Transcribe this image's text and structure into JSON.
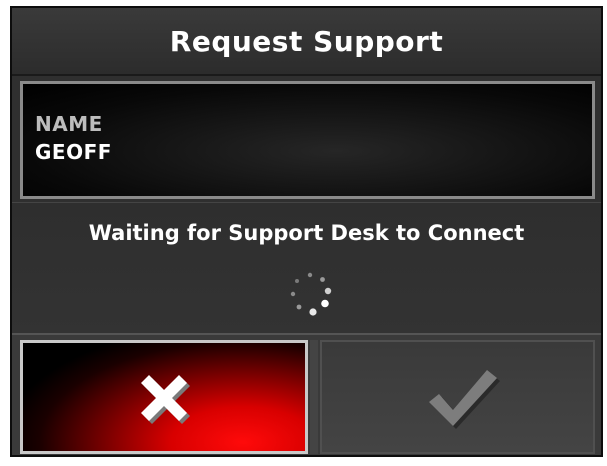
{
  "dialog": {
    "title": "Request Support",
    "name_field": {
      "label": "NAME",
      "value": "GEOFF"
    },
    "status": {
      "message": "Waiting for Support Desk to Connect",
      "indicator_icon": "loading-spinner-icon"
    },
    "buttons": {
      "cancel": {
        "icon": "close-icon",
        "color": "#e00000"
      },
      "confirm": {
        "icon": "checkmark-icon",
        "color": "#7a7a7a"
      }
    }
  }
}
